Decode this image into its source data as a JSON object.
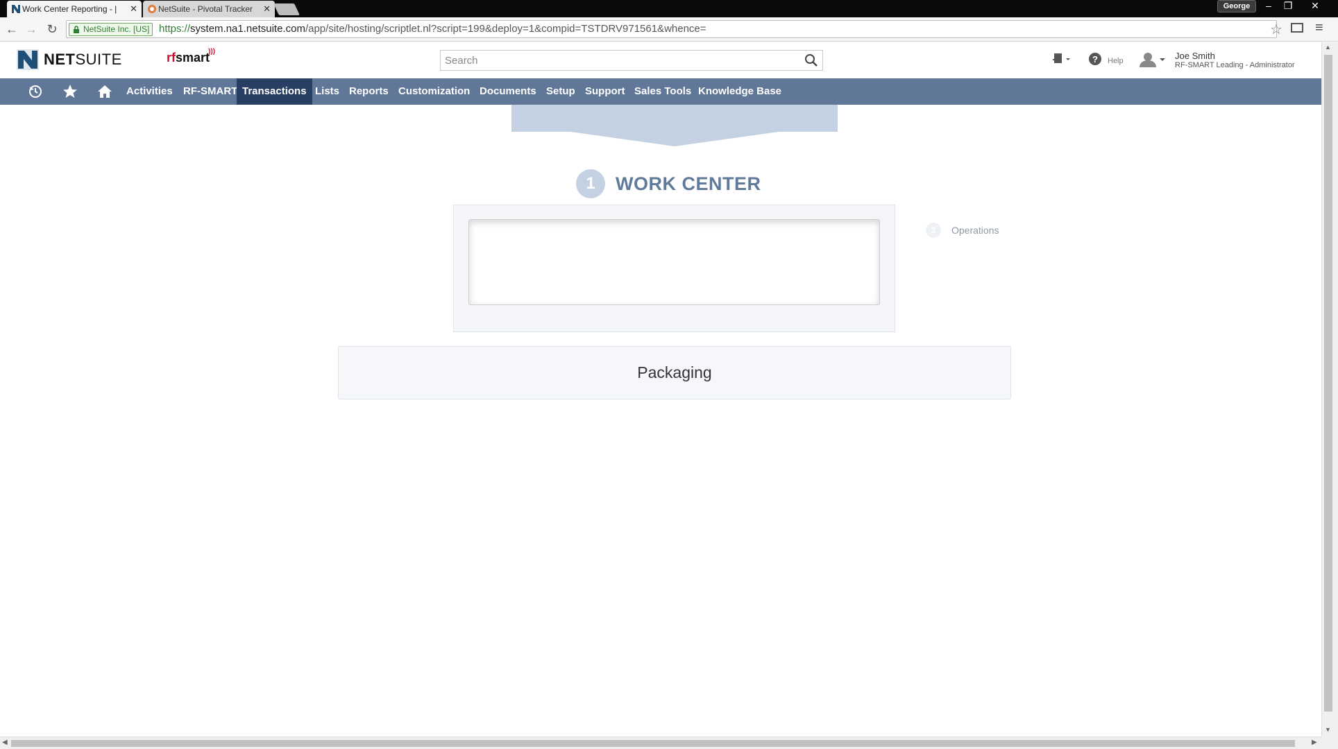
{
  "browser": {
    "tabs": [
      {
        "title": "Work Center Reporting - |",
        "close": "✕"
      },
      {
        "title": "NetSuite - Pivotal Tracker",
        "close": "✕"
      }
    ],
    "profile_name": "George",
    "window_controls": {
      "minimize": "–",
      "restore": "❐",
      "close": "✕"
    },
    "security_chip": "NetSuite Inc. [US]",
    "url_scheme": "https://",
    "url_host": "system.na1.netsuite.com",
    "url_rest": "/app/site/hosting/scriptlet.nl?script=199&deploy=1&compid=TSTDRV971561&whence=",
    "nav": {
      "back": "←",
      "forward": "→",
      "reload": "↻"
    }
  },
  "header": {
    "logo_text_bold": "NET",
    "logo_text": "SUITE",
    "partner_logo_prefix": "rf",
    "partner_logo_suffix": "smart",
    "search_placeholder": "Search",
    "help_label": "Help",
    "user_name": "Joe Smith",
    "user_role": "RF-SMART Leading - Administrator"
  },
  "navbar": {
    "items": [
      {
        "label": "Activities",
        "active": false
      },
      {
        "label": "RF-SMART",
        "active": false
      },
      {
        "label": "Transactions",
        "active": true
      },
      {
        "label": "Lists",
        "active": false
      },
      {
        "label": "Reports",
        "active": false
      },
      {
        "label": "Customization",
        "active": false
      },
      {
        "label": "Documents",
        "active": false
      },
      {
        "label": "Setup",
        "active": false
      },
      {
        "label": "Support",
        "active": false
      },
      {
        "label": "Sales Tools",
        "active": false
      },
      {
        "label": "Knowledge Base",
        "active": false
      }
    ]
  },
  "main": {
    "step1_number": "1",
    "step1_title": "WORK CENTER",
    "work_center_input_value": "",
    "step2_number": "2",
    "step2_label": "Operations",
    "option_packaging": "Packaging"
  },
  "colors": {
    "navbar_bg": "#607798",
    "navbar_active": "#283f63",
    "step_title": "#5f7a9b",
    "chevron_fill": "#c3d1e2"
  }
}
